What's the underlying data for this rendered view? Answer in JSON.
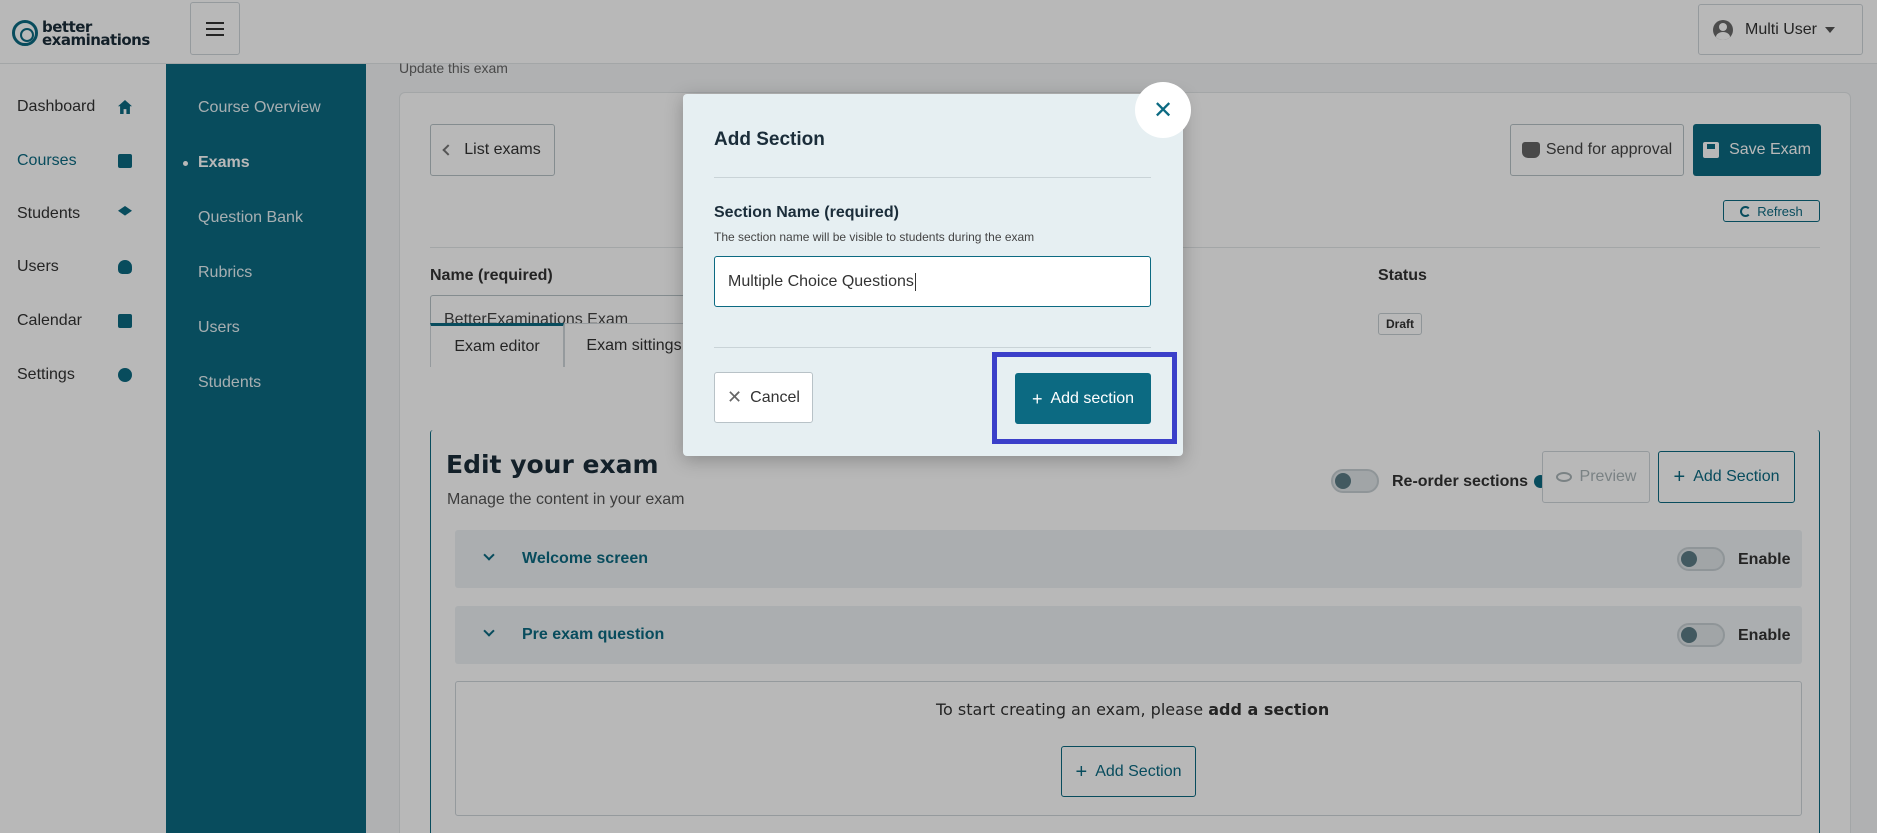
{
  "brand": {
    "line1": "better",
    "line2": "examinations"
  },
  "header": {
    "user_name": "Multi User"
  },
  "left_nav": [
    {
      "label": "Dashboard",
      "icon": "home-icon"
    },
    {
      "label": "Courses",
      "icon": "book-icon"
    },
    {
      "label": "Students",
      "icon": "graduate-icon"
    },
    {
      "label": "Users",
      "icon": "users-icon"
    },
    {
      "label": "Calendar",
      "icon": "calendar-icon"
    },
    {
      "label": "Settings",
      "icon": "gear-icon"
    }
  ],
  "course_nav": [
    {
      "label": "Course Overview",
      "active": false
    },
    {
      "label": "Exams",
      "active": true
    },
    {
      "label": "Question Bank",
      "active": false
    },
    {
      "label": "Rubrics",
      "active": false
    },
    {
      "label": "Users",
      "active": false
    },
    {
      "label": "Students",
      "active": false
    }
  ],
  "page": {
    "subtitle": "Update this exam",
    "list_exams": "List exams",
    "send_approval": "Send for approval",
    "save_exam": "Save Exam",
    "refresh": "Refresh",
    "name_label": "Name (required)",
    "name_value": "BetterExaminations Exam",
    "status_label": "Status",
    "status_value": "Draft"
  },
  "tabs": [
    {
      "label": "Exam editor",
      "active": true
    },
    {
      "label": "Exam sittings",
      "active": false
    }
  ],
  "editor": {
    "title": "Edit your exam",
    "subtitle": "Manage the content in your exam",
    "reorder_label": "Re-order sections",
    "preview": "Preview",
    "add_section": "Add Section",
    "sections": [
      {
        "title": "Welcome screen",
        "toggle_label": "Enable"
      },
      {
        "title": "Pre exam question",
        "toggle_label": "Enable"
      }
    ],
    "empty_text_prefix": "To start creating an exam, please ",
    "empty_text_bold": "add a section",
    "empty_add_section": "Add Section"
  },
  "modal": {
    "title": "Add Section",
    "field_label": "Section Name (required)",
    "field_help": "The section name will be visible to students during the exam",
    "field_value": "Multiple Choice Questions",
    "cancel": "Cancel",
    "submit": "Add section"
  },
  "colors": {
    "brand_teal": "#0c6a82",
    "highlight": "#3b3fc9"
  }
}
